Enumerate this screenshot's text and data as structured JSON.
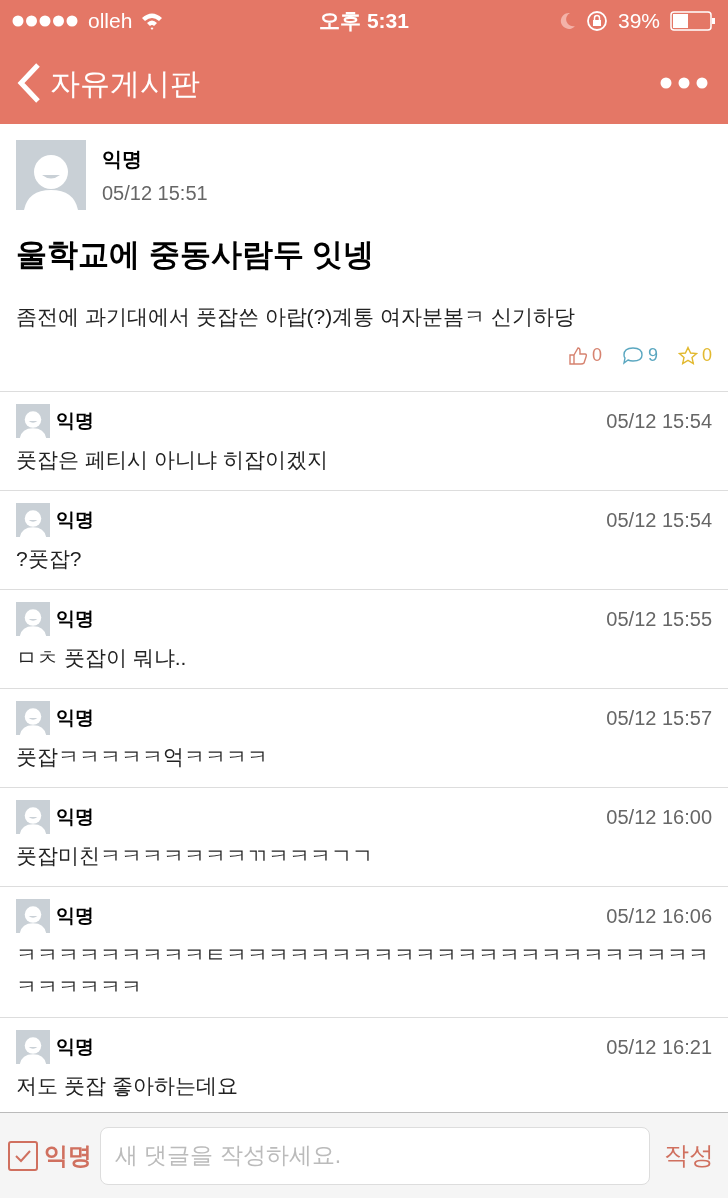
{
  "status_bar": {
    "carrier": "olleh",
    "time": "오후 5:31",
    "battery": "39%"
  },
  "header": {
    "title": "자유게시판"
  },
  "post": {
    "author": "익명",
    "time": "05/12 15:51",
    "title": "울학교에 중동사람두 잇넹",
    "body": "좀전에 과기대에서 풋잡쓴 아랍(?)계통 여자분봄ㅋ 신기하당",
    "likes": "0",
    "comments": "9",
    "scraps": "0"
  },
  "comments": [
    {
      "author": "익명",
      "time": "05/12 15:54",
      "text": "풋잡은 페티시 아니냐 히잡이겠지"
    },
    {
      "author": "익명",
      "time": "05/12 15:54",
      "text": "?풋잡?"
    },
    {
      "author": "익명",
      "time": "05/12 15:55",
      "text": "ㅁㅊ 풋잡이 뭐냐.."
    },
    {
      "author": "익명",
      "time": "05/12 15:57",
      "text": "풋잡ㅋㅋㅋㅋㅋ억ㅋㅋㅋㅋ"
    },
    {
      "author": "익명",
      "time": "05/12 16:00",
      "text": "풋잡미친ㅋㅋㅋㅋㅋㅋㅋㄲㅋㅋㅋㄱㄱ"
    },
    {
      "author": "익명",
      "time": "05/12 16:06",
      "text": "ㅋㅋㅋㅋㅋㅋㅋㅋㅋㅌㅋㅋㅋㅋㅋㅋㅋㅋㅋㅋㅋㅋㅋㅋㅋㅋㅋㅋㅋㅋㅋㅋㅋㅋㅋㅋㅋㅋㅋ"
    },
    {
      "author": "익명",
      "time": "05/12 16:21",
      "text": "저도 풋잡 좋아하는데요"
    }
  ],
  "composer": {
    "anonymous": {
      "label": "익명",
      "checked": true
    },
    "placeholder": "새 댓글을 작성하세요.",
    "submit": "작성"
  }
}
